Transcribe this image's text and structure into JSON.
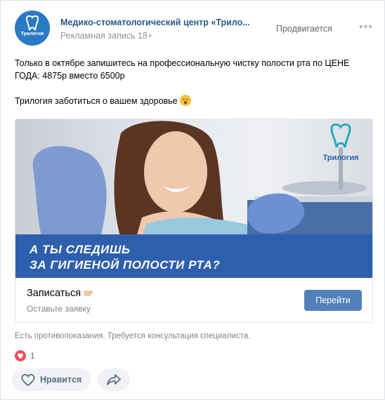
{
  "post": {
    "author": "Медико-стоматологический центр «Трило...",
    "subtitle": "Рекламная запись 18+",
    "promoted_label": "Продвигается",
    "more_label": "•••",
    "avatar_text": "Трилогия",
    "text_line1": "Только в октябре запишитесь на профессиональную чистку полости рта по ЦЕНЕ",
    "text_line2": "ГОДА: 4875р вместо 6500р",
    "text_line3": "Трилогия заботиться о вашем здоровье",
    "ad": {
      "banner_line1": "А ТЫ СЛЕДИШЬ",
      "banner_line2": "ЗА ГИГИЕНОЙ ПОЛОСТИ РТА?",
      "logo_name": "Трилогия",
      "cta_title": "Записаться",
      "cta_subtitle": "Оставьте заявку",
      "cta_button": "Перейти"
    },
    "disclaimer": "Есть противопоказания. Требуется консультация специалиста.",
    "reaction_count": "1",
    "like_label": "Нравится"
  },
  "colors": {
    "link": "#2a5885",
    "button": "#5181b8",
    "banner": "#2e5fae",
    "reaction": "#f04e63"
  },
  "icons": [
    "tooth-logo-icon",
    "heart-reaction-icon",
    "heart-outline-icon",
    "share-arrow-icon",
    "pointing-hand-emoji",
    "smiling-face-emoji",
    "more-dots-icon"
  ]
}
